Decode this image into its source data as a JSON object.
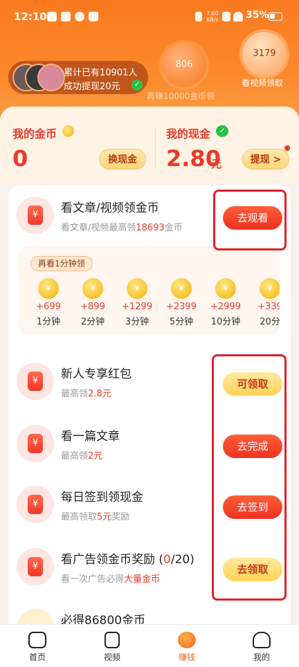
{
  "status_bar": {
    "time": "12:10",
    "net_speed": "7.60",
    "net_unit": "KB/s",
    "battery": "35%"
  },
  "header": {
    "winners_line1": "累计已有10901人",
    "winners_line2": "成功提现20元",
    "bubble_left_value": "806",
    "bubble_left_caption": "再赚10000金币领",
    "bubble_right_value": "3179",
    "bubble_right_caption": "看视频领取"
  },
  "wallet": {
    "coins_label": "我的金币",
    "coins_value": "0",
    "exchange_label": "换现金",
    "cash_label": "我的现金",
    "cash_value": "2.80",
    "cash_unit": "元",
    "withdraw_label": "提现 >"
  },
  "tasks": [
    {
      "title": "看文章/视频领金币",
      "sub_prefix": "看文章/视频最高领",
      "sub_highlight": "18693",
      "sub_suffix": "金币",
      "button": "去观看"
    },
    {
      "title": "新人专享红包",
      "sub_prefix": "最高领",
      "sub_highlight": "2.8元",
      "sub_suffix": "",
      "button": "可领取"
    },
    {
      "title": "看一篇文章",
      "sub_prefix": "最高领",
      "sub_highlight": "2元",
      "sub_suffix": "",
      "button": "去完成"
    },
    {
      "title": "每日签到领现金",
      "sub_prefix": "最高领取",
      "sub_highlight": "5元",
      "sub_suffix": "奖励",
      "button": "去签到"
    },
    {
      "title": "看广告领金币奖励 (",
      "title_count": "0",
      "title_tail": "/20)",
      "sub_prefix": "看一次广告必得",
      "sub_highlight": "大量金币",
      "sub_suffix": "",
      "button": "去领取"
    },
    {
      "title": "必得86800金币"
    }
  ],
  "minutes": {
    "tag": "再看1分钟领",
    "items": [
      {
        "value": "+699",
        "time": "1分钟"
      },
      {
        "value": "+899",
        "time": "2分钟"
      },
      {
        "value": "+1299",
        "time": "3分钟"
      },
      {
        "value": "+2399",
        "time": "5分钟"
      },
      {
        "value": "+2999",
        "time": "10分钟"
      },
      {
        "value": "+339",
        "time": "20分"
      }
    ]
  },
  "tabbar": [
    {
      "label": "首页",
      "icon": "home-icon"
    },
    {
      "label": "视频",
      "icon": "video-icon"
    },
    {
      "label": "赚钱",
      "icon": "earn-money-icon"
    },
    {
      "label": "我的",
      "icon": "profile-icon"
    }
  ],
  "colors": {
    "accent": "#f2681e",
    "red": "#e83a2a",
    "header": "#fb7a1f"
  }
}
